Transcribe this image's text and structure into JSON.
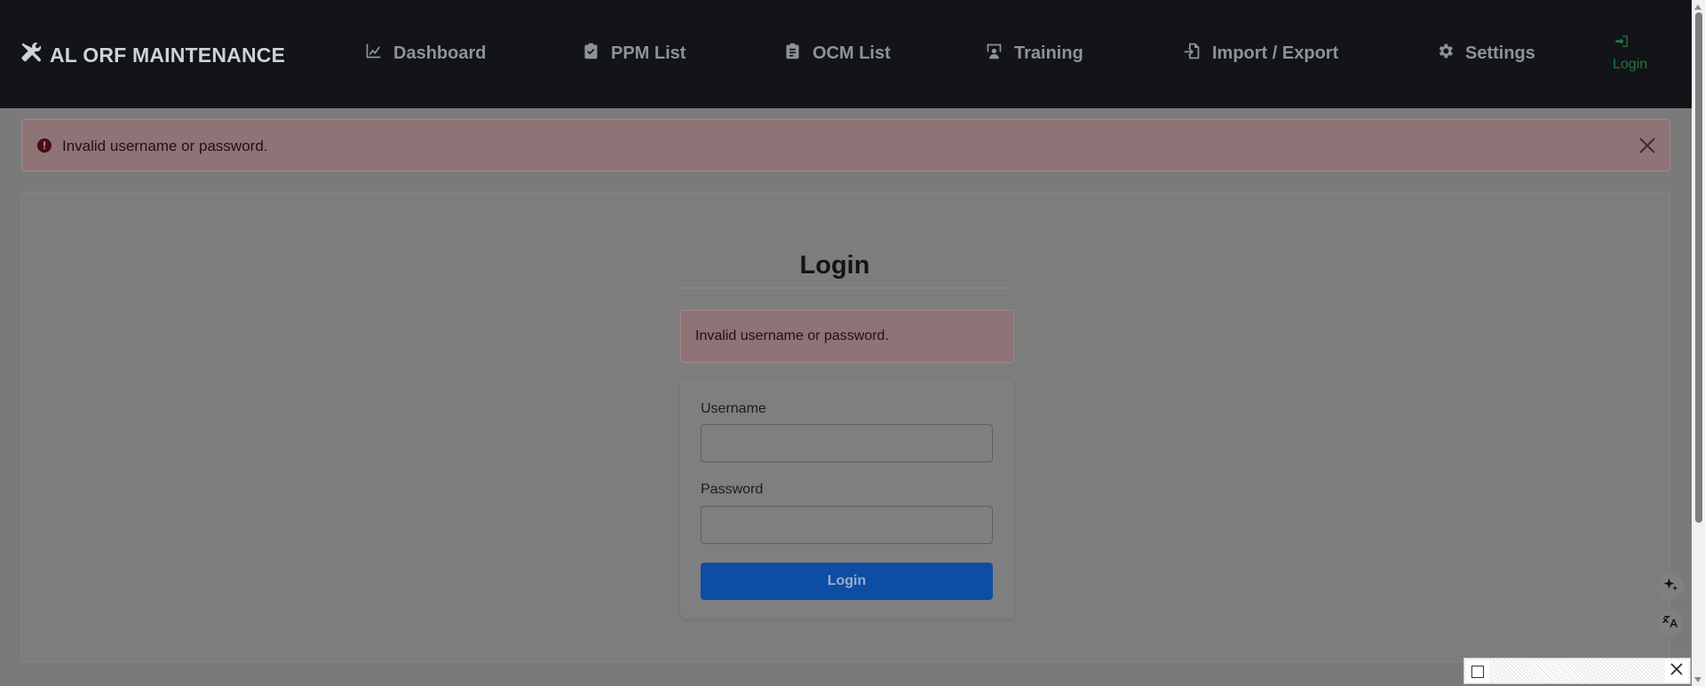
{
  "navbar": {
    "brand": "AL ORF MAINTENANCE",
    "brand_icon": "tools-icon",
    "items": [
      {
        "label": "Dashboard",
        "icon": "chart-line-icon"
      },
      {
        "label": "PPM List",
        "icon": "clipboard-check-icon"
      },
      {
        "label": "OCM List",
        "icon": "clipboard-list-icon"
      },
      {
        "label": "Training",
        "icon": "chalkboard-teacher-icon"
      },
      {
        "label": "Import / Export",
        "icon": "file-import-icon"
      },
      {
        "label": "Settings",
        "icon": "gear-icon"
      }
    ],
    "login": {
      "label": "Login",
      "icon": "sign-in-icon",
      "color": "#1e7a3e"
    }
  },
  "alert": {
    "message": "Invalid username or password.",
    "icon": "exclamation-circle-icon"
  },
  "login_form": {
    "title": "Login",
    "error_message": "Invalid username or password.",
    "username_label": "Username",
    "username_value": "",
    "password_label": "Password",
    "password_value": "",
    "submit_label": "Login"
  },
  "floating_buttons": [
    {
      "icon": "sparkle-icon"
    },
    {
      "icon": "translate-icon"
    }
  ],
  "colors": {
    "navbar_bg": "#121417",
    "alert_bg": "#8e7476",
    "primary_button": "#0d4da4",
    "login_link": "#1e7a3e"
  }
}
